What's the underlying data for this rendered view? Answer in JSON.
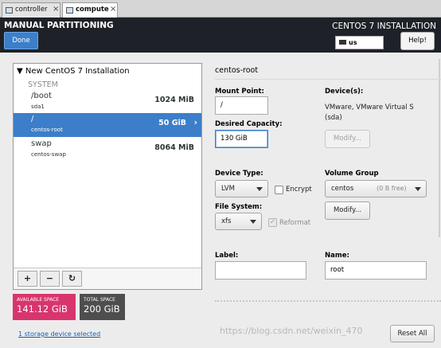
{
  "vm_tabs": [
    {
      "label": "controller",
      "active": false
    },
    {
      "label": "compute",
      "active": true
    }
  ],
  "header": {
    "title": "MANUAL PARTITIONING",
    "done_label": "Done",
    "installation_title": "CENTOS 7 INSTALLATION",
    "keyboard_layout": "us",
    "help_label": "Help!"
  },
  "partitions": {
    "installation_title": "New CentOS 7 Installation",
    "group_label": "SYSTEM",
    "items": [
      {
        "mount": "/boot",
        "device": "sda1",
        "size": "1024 MiB",
        "selected": false
      },
      {
        "mount": "/",
        "device": "centos-root",
        "size": "50 GiB",
        "selected": true
      },
      {
        "mount": "swap",
        "device": "centos-swap",
        "size": "8064 MiB",
        "selected": false
      }
    ],
    "toolbar": {
      "add": "+",
      "remove": "−",
      "refresh": "↻"
    }
  },
  "space": {
    "available_caption": "AVAILABLE SPACE",
    "available_value": "141.12 GiB",
    "total_caption": "TOTAL SPACE",
    "total_value": "200 GiB",
    "storage_link": "1 storage device selected"
  },
  "details": {
    "title": "centos-root",
    "mount_point_label": "Mount Point:",
    "mount_point_value": "/",
    "capacity_label": "Desired Capacity:",
    "capacity_value": "130 GiB",
    "devices_label": "Device(s):",
    "devices_text_1": "VMware, VMware Virtual S",
    "devices_text_2": "(sda)",
    "modify_label": "Modify...",
    "device_type_label": "Device Type:",
    "device_type_value": "LVM",
    "encrypt_label": "Encrypt",
    "volume_group_label": "Volume Group",
    "volume_group_value": "centos",
    "volume_group_free": "(0 B free)",
    "vg_modify_label": "Modify...",
    "file_system_label": "File System:",
    "file_system_value": "xfs",
    "reformat_label": "Reformat",
    "label_label": "Label:",
    "label_value": "",
    "name_label": "Name:",
    "name_value": "root",
    "reset_label": "Reset All"
  },
  "watermark": "https://blog.csdn.net/weixin_470",
  "colors": {
    "header_bg": "#1e2228",
    "accent": "#3c7ec9",
    "available_bg": "#d8356e",
    "total_bg": "#4e4e4e"
  }
}
